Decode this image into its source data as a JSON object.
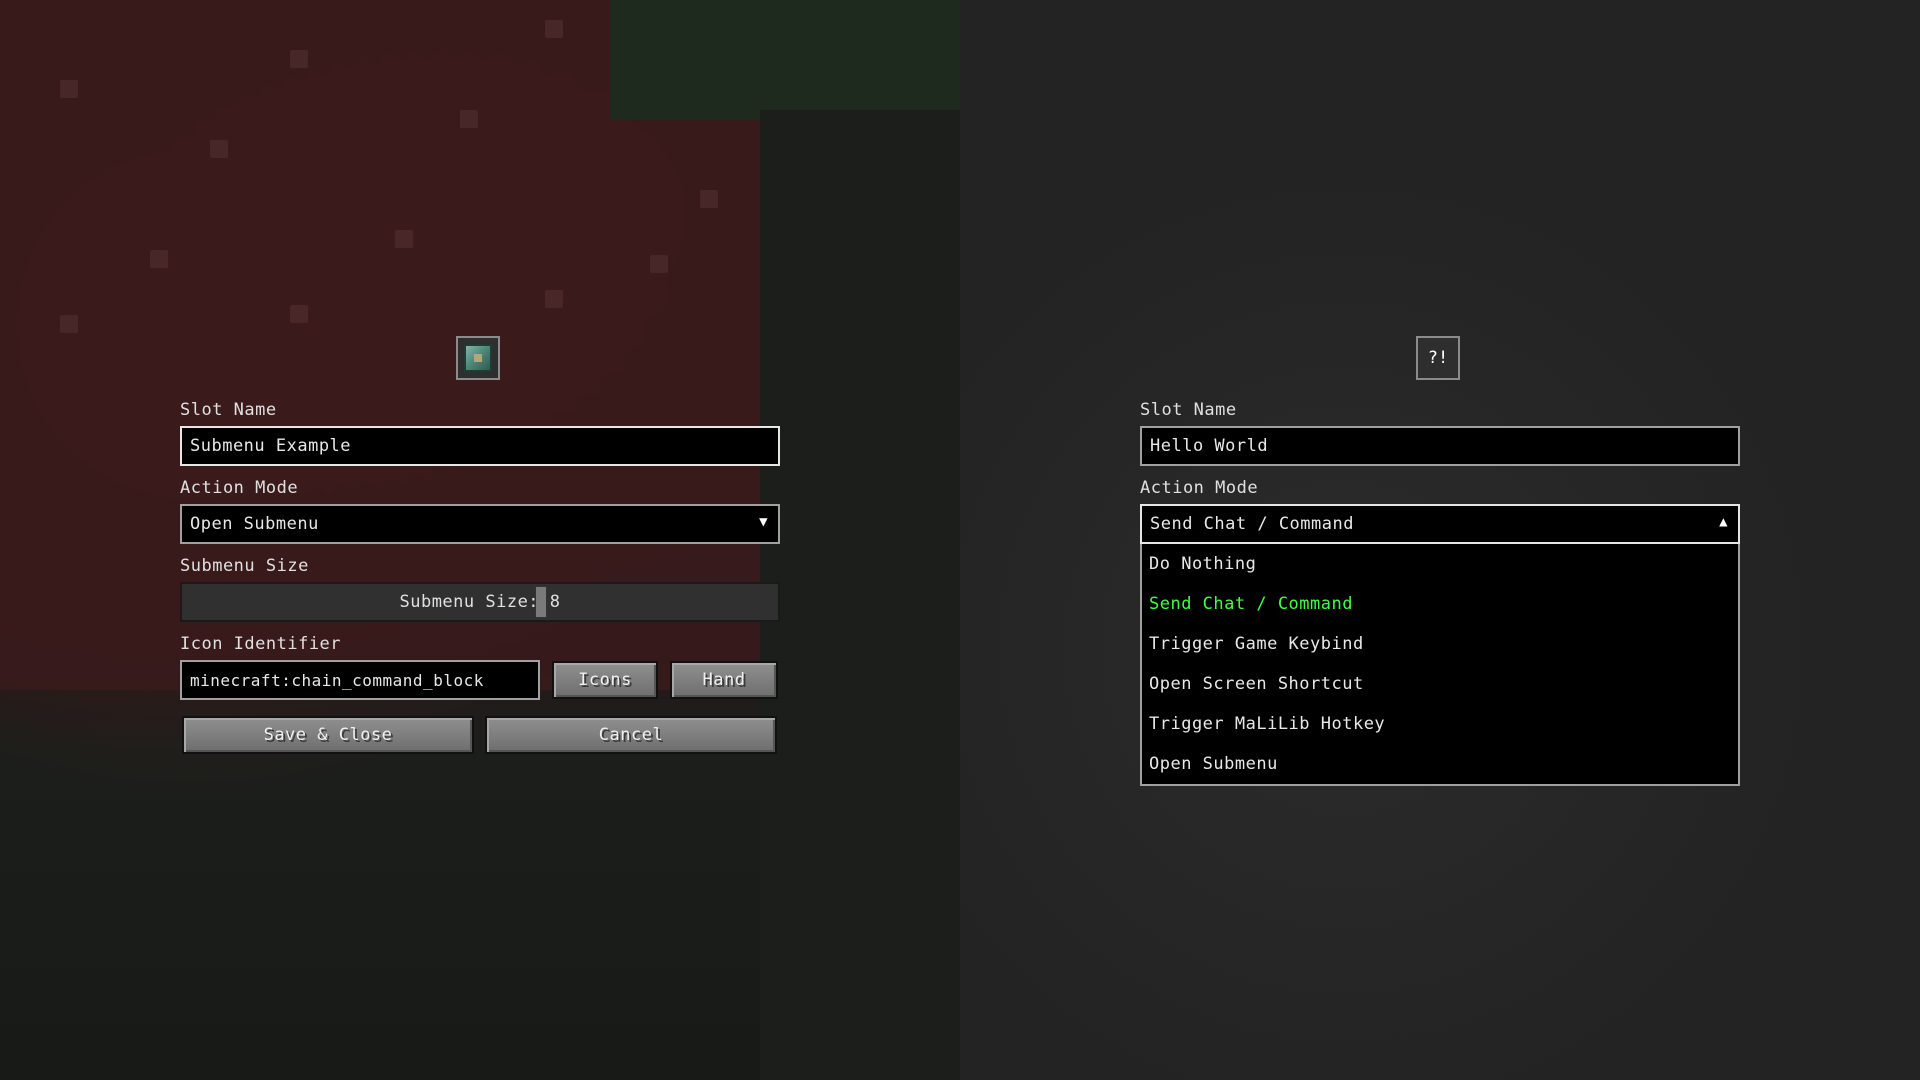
{
  "left_panel": {
    "icon": "chain-command-block-icon",
    "slot_name_label": "Slot Name",
    "slot_name_value": "Submenu Example",
    "action_mode_label": "Action Mode",
    "action_mode_value": "Open Submenu",
    "action_mode_arrow": "▼",
    "submenu_size_label": "Submenu Size",
    "submenu_size_slider_text": "Submenu Size: 8",
    "submenu_size_value": 8,
    "icon_identifier_label": "Icon Identifier",
    "icon_identifier_value": "minecraft:chain_command_block",
    "icons_button": "Icons",
    "hand_button": "Hand",
    "save_button": "Save & Close",
    "cancel_button": "Cancel"
  },
  "right_panel": {
    "icon_text": "?!",
    "slot_name_label": "Slot Name",
    "slot_name_value": "Hello World",
    "action_mode_label": "Action Mode",
    "action_mode_value": "Send Chat / Command",
    "action_mode_arrow": "▲",
    "dropdown_options": [
      "Do Nothing",
      "Send Chat / Command",
      "Trigger Game Keybind",
      "Open Screen Shortcut",
      "Trigger MaLiLib Hotkey",
      "Open Submenu"
    ],
    "selected_option": "Send Chat / Command"
  },
  "colors": {
    "selected_option": "#40ff40",
    "field_border": "#a0a0a0",
    "button_face": "#7f7f7f"
  }
}
